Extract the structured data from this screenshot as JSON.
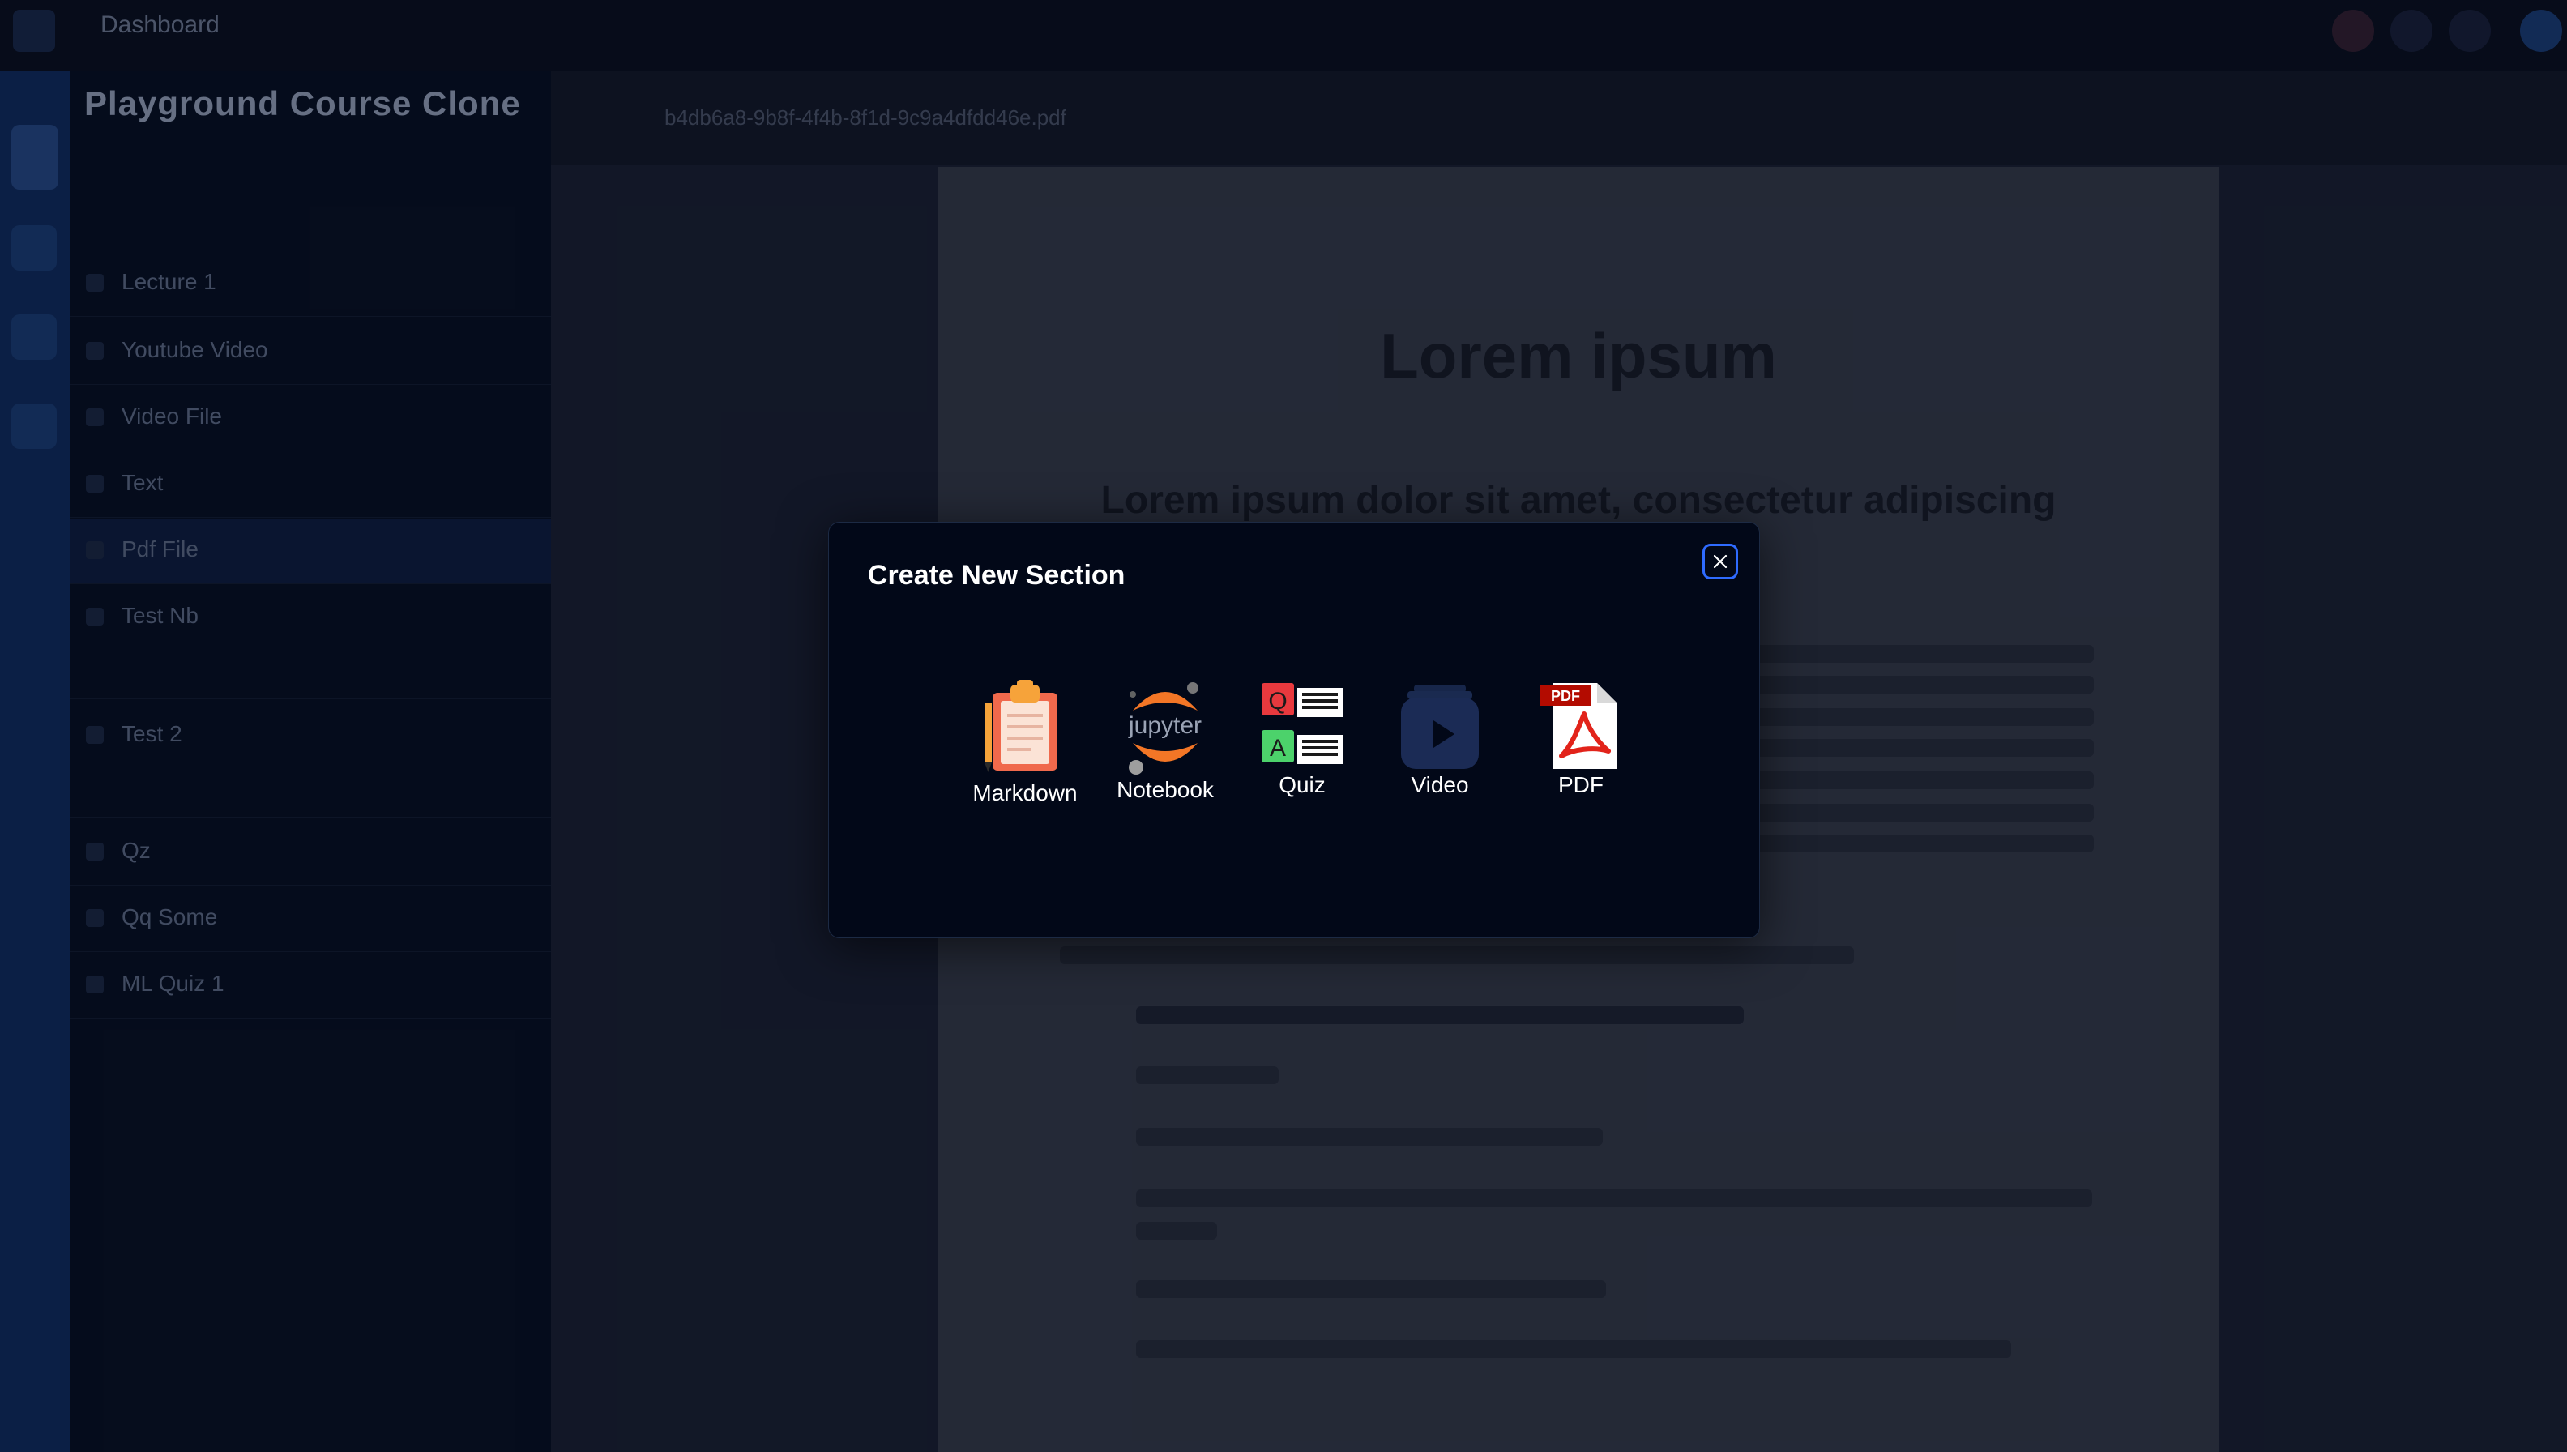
{
  "app": {
    "brand": "Dashboard",
    "course_title": "Playground Course Clone",
    "pdf_file_name": "b4db6a8-9b8f-4f4b-8f1d-9c9a4dfdd46e.pdf"
  },
  "sidebar": {
    "items": [
      {
        "label": "Lecture 1"
      },
      {
        "label": "Youtube Video"
      },
      {
        "label": "Video File"
      },
      {
        "label": "Text"
      },
      {
        "label": "Pdf File"
      },
      {
        "label": "Test Nb"
      },
      {
        "label": "Test 2"
      },
      {
        "label": "Qz"
      },
      {
        "label": "Qq Some"
      },
      {
        "label": "ML Quiz 1"
      }
    ]
  },
  "pdf": {
    "title": "Lorem ipsum",
    "heading": "Lorem ipsum dolor sit amet, consectetur adipiscing"
  },
  "modal": {
    "title": "Create New Section",
    "options": [
      {
        "label": "Markdown",
        "icon": "clipboard-icon"
      },
      {
        "label": "Notebook",
        "icon": "jupyter-icon"
      },
      {
        "label": "Quiz",
        "icon": "quiz-icon"
      },
      {
        "label": "Video",
        "icon": "video-icon"
      },
      {
        "label": "PDF",
        "icon": "pdf-icon"
      }
    ]
  },
  "colors": {
    "modal_bg": "#020818",
    "accent_blue": "#2f6bff",
    "jupyter_orange": "#f37626",
    "pdf_red": "#e2231a",
    "quiz_red": "#e8393e",
    "quiz_green": "#4cd26b",
    "video_bg": "#1b2b55"
  }
}
